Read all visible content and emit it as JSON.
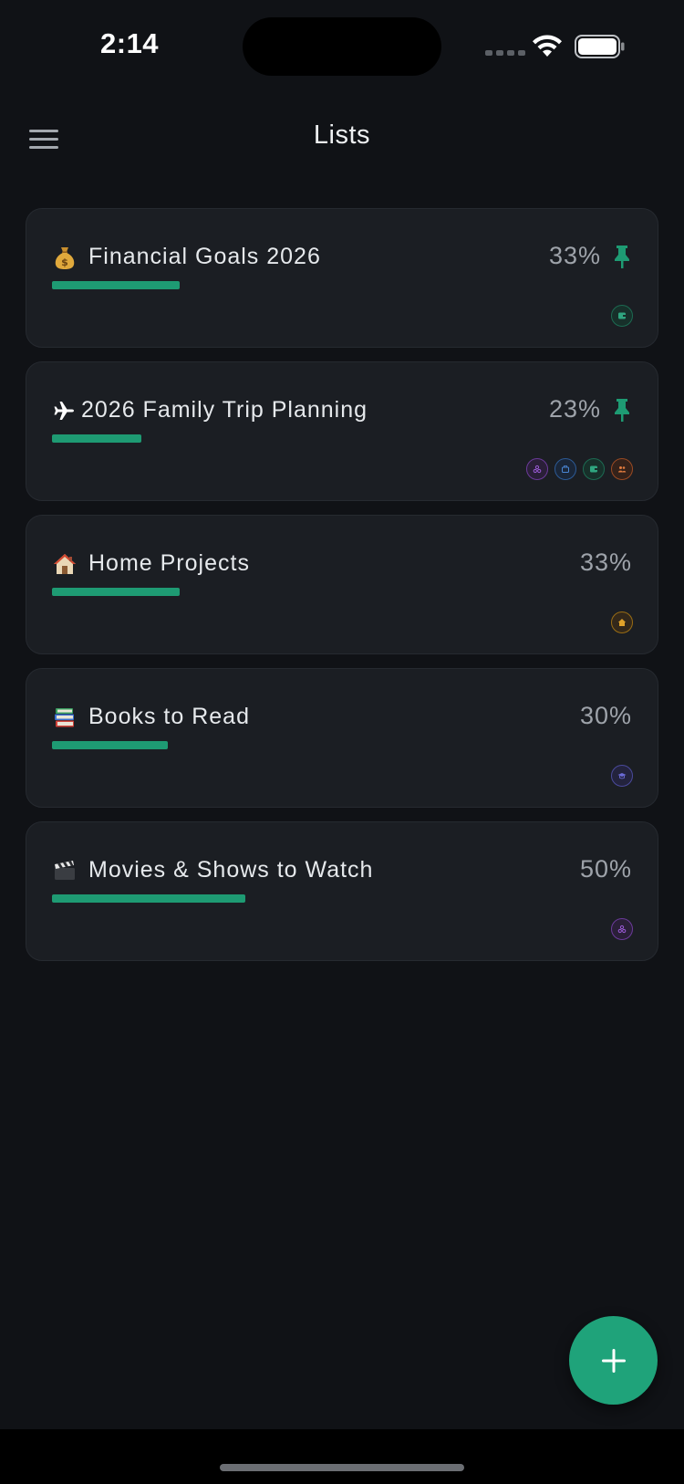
{
  "status_bar": {
    "time": "2:14"
  },
  "header": {
    "title": "Lists"
  },
  "lists": [
    {
      "emoji": "💰",
      "title": "Financial Goals 2026",
      "percent_label": "33%",
      "progress": 0.33,
      "pinned": true,
      "tags": [
        "green"
      ]
    },
    {
      "emoji": "✈",
      "title": "2026 Family Trip Planning",
      "percent_label": "23%",
      "progress": 0.23,
      "pinned": true,
      "tags": [
        "purple",
        "blue",
        "green",
        "orange"
      ]
    },
    {
      "emoji": "🏠",
      "title": "Home Projects",
      "percent_label": "33%",
      "progress": 0.33,
      "pinned": false,
      "tags": [
        "amber"
      ]
    },
    {
      "emoji": "📚",
      "title": "Books to Read",
      "percent_label": "30%",
      "progress": 0.3,
      "pinned": false,
      "tags": [
        "indigo"
      ]
    },
    {
      "emoji": "🎬",
      "title": "Movies & Shows to Watch",
      "percent_label": "50%",
      "progress": 0.5,
      "pinned": false,
      "tags": [
        "purple"
      ]
    }
  ],
  "colors": {
    "background": "#101216",
    "card": "#1b1e23",
    "accent": "#1e9b73",
    "fab": "#1fa37a"
  }
}
